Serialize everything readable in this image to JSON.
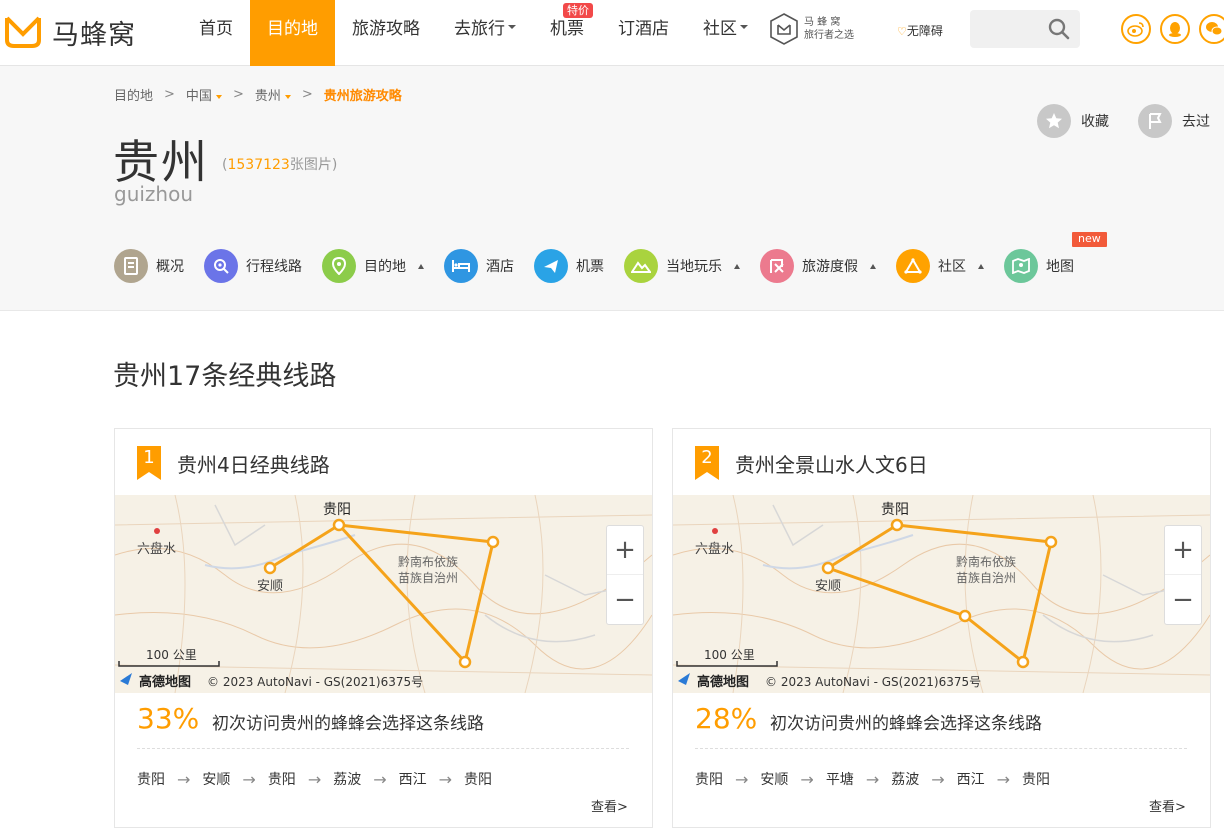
{
  "header": {
    "logo_text": "马蜂窝",
    "nav": [
      {
        "label": "首页",
        "caret": false
      },
      {
        "label": "目的地",
        "caret": false,
        "active": true
      },
      {
        "label": "旅游攻略",
        "caret": false
      },
      {
        "label": "去旅行",
        "caret": true
      },
      {
        "label": "机票",
        "caret": false,
        "badge": "特价"
      },
      {
        "label": "订酒店",
        "caret": false
      },
      {
        "label": "社区",
        "caret": true
      }
    ],
    "brand2_line1": "马 蜂 窝",
    "brand2_line2": "旅行者之选",
    "accessibility": "无障碍",
    "search_placeholder": "",
    "social_icons": [
      "weibo-icon",
      "qq-icon",
      "wechat-icon"
    ]
  },
  "destination": {
    "breadcrumb": [
      "目的地",
      "中国",
      "贵州",
      "贵州旅游攻略"
    ],
    "name": "贵州",
    "photo_count": "1537123",
    "photo_unit": "张图片",
    "pinyin": "guizhou",
    "actions": {
      "favorite": "收藏",
      "visited": "去过"
    },
    "subnav": [
      {
        "label": "概况",
        "icon": "overview-icon",
        "color": "#b0a58f",
        "dropdown": false
      },
      {
        "label": "行程线路",
        "icon": "route-icon",
        "color": "#6b74e8",
        "dropdown": false
      },
      {
        "label": "目的地",
        "icon": "location-pin-icon",
        "color": "#8ccc4a",
        "dropdown": true
      },
      {
        "label": "酒店",
        "icon": "hotel-bed-icon",
        "color": "#2f96e2",
        "dropdown": false
      },
      {
        "label": "机票",
        "icon": "plane-icon",
        "color": "#2aa3e6",
        "dropdown": false
      },
      {
        "label": "当地玩乐",
        "icon": "mountain-icon",
        "color": "#a9d33e",
        "dropdown": true
      },
      {
        "label": "旅游度假",
        "icon": "vacation-icon",
        "color": "#ec7a8e",
        "dropdown": true
      },
      {
        "label": "社区",
        "icon": "community-icon",
        "color": "#ffa200",
        "dropdown": true
      },
      {
        "label": "地图",
        "icon": "map-icon",
        "color": "#6cc79a",
        "dropdown": false,
        "badge": "new"
      }
    ]
  },
  "section_title": "贵州17条经典线路",
  "routes": [
    {
      "rank": "1",
      "title": "贵州4日经典线路",
      "percent": "33%",
      "percent_text": "初次访问贵州的蜂蜂会选择这条线路",
      "stops": [
        "贵阳",
        "安顺",
        "贵阳",
        "荔波",
        "西江",
        "贵阳"
      ],
      "more": "查看>"
    },
    {
      "rank": "2",
      "title": "贵州全景山水人文6日",
      "percent": "28%",
      "percent_text": "初次访问贵州的蜂蜂会选择这条线路",
      "stops": [
        "贵阳",
        "安顺",
        "平塘",
        "荔波",
        "西江",
        "贵阳"
      ],
      "more": "查看>"
    }
  ],
  "map": {
    "labels": {
      "guiyang": "贵阳",
      "anshun": "安顺",
      "liupanshui": "六盘水",
      "qiannan_1": "黔南布依族",
      "qiannan_2": "苗族自治州"
    },
    "scale": "100 公里",
    "copyright": "© 2023 AutoNavi - GS(2021)6375号",
    "provider": "高德地图",
    "zoom_in": "+",
    "zoom_out": "−",
    "route_color": "#f5a31a"
  }
}
